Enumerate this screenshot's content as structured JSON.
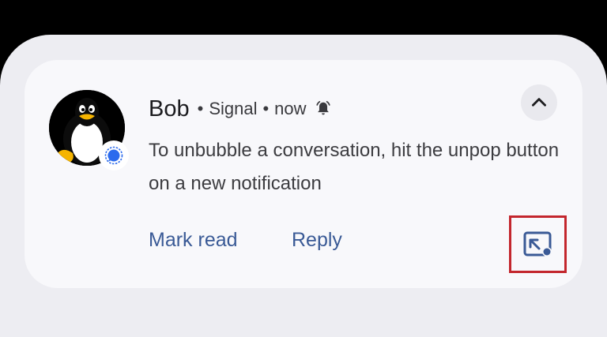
{
  "notification": {
    "sender": "Bob",
    "separator": "•",
    "app_name": "Signal",
    "time": "now",
    "message": "To unbubble a conversation, hit the unpop button on a new notification",
    "avatar_icon": "tux-penguin-icon",
    "app_badge_icon": "signal-chat-icon",
    "alert_icon": "bell-ringing-icon",
    "collapse_icon": "chevron-up-icon"
  },
  "actions": {
    "mark_read": "Mark read",
    "reply": "Reply",
    "unpop_icon": "unpop-bubble-icon"
  },
  "colors": {
    "accent": "#3a5a96",
    "highlight": "#c3262d"
  }
}
